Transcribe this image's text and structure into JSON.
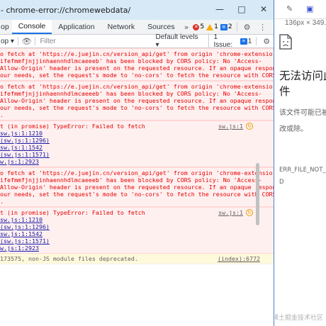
{
  "devtools": {
    "title": "- chrome-error://chromewebdata/",
    "tabs": [
      "op",
      "Console",
      "Application",
      "Network",
      "Sources"
    ],
    "active_tab": "Console",
    "badges": {
      "errors": "5",
      "warnings": "1",
      "info": "2"
    },
    "toolbar": {
      "filter_placeholder": "Filter",
      "levels_label": "Default levels ▾",
      "issues_label": "1 Issue:",
      "issues_count": "1",
      "left_label": "op ▾"
    },
    "messages": [
      {
        "kind": "error",
        "lines": [
          "o fetch at 'https://e.juejin.cn/version_api/get' from origin 'chrome-extensio",
          "ifefmmfjnjjinhaennhdlmcaeeeb' has been blocked by CORS policy: No 'Access-",
          "Allow-Origin' header is present on the requested resource. If an opaque response",
          "our needs, set the request's mode to 'no-cors' to fetch the resource with CORS"
        ]
      },
      {
        "kind": "error",
        "lines": [
          "o fetch at 'https://e.juejin.cn/version_api/get' from origin 'chrome-extensio",
          "ifefmmfjnjjinhaennhdlmcaeeeb' has been blocked by CORS policy: No 'Access-",
          "Allow-Origin' header is present on the requested resource. If an opaque response",
          "our needs, set the request's mode to 'no-cors' to fetch the resource with CORS",
          "."
        ]
      },
      {
        "kind": "error-stack",
        "lines": [
          "t (in promise) TypeError: Failed to fetch"
        ],
        "source": "sw.js:1",
        "stack": [
          "sw.js:1:1210",
          "(sw.js:1:1296)",
          "sw.js:1:1542",
          "(sw.js:1:1571)",
          "w.js:1:2923"
        ]
      },
      {
        "kind": "error",
        "lines": [
          "o fetch at 'https://e.juejin.cn/version_api/get' from origin 'chrome-extensio",
          "ifefmmfjnjjinhaennhdlmcaeeeb' has been blocked by CORS policy: No 'Access-",
          "Allow-Origin' header is present on the requested resource. If an opaque response",
          "our needs, set the request's mode to 'no-cors' to fetch the resource with CORS",
          "."
        ]
      },
      {
        "kind": "error-stack",
        "lines": [
          "t (in promise) TypeError: Failed to fetch"
        ],
        "source": "sw.js:1",
        "stack": [
          "sw.js:1:1210",
          "(sw.js:1:1296)",
          "sw.js:1:1542",
          "(sw.js:1:1571)",
          "w.js:1:2923"
        ]
      },
      {
        "kind": "info",
        "lines": [
          "173575, non-JS module files deprecated."
        ],
        "source": "(index):6772"
      }
    ]
  },
  "browser": {
    "size_text": "136px × 349.",
    "error_title": "无法访问此的文件",
    "error_desc": "该文件可能已被至别处、修改或除。",
    "error_code": "ERR_FILE_NOT_FO",
    "error_code_2": "D",
    "watermark": "@稀土掘金技术社区"
  },
  "colors": {
    "error_text": "#e50000",
    "error_bg": "#fff0f0",
    "accent": "#1a73e8"
  }
}
